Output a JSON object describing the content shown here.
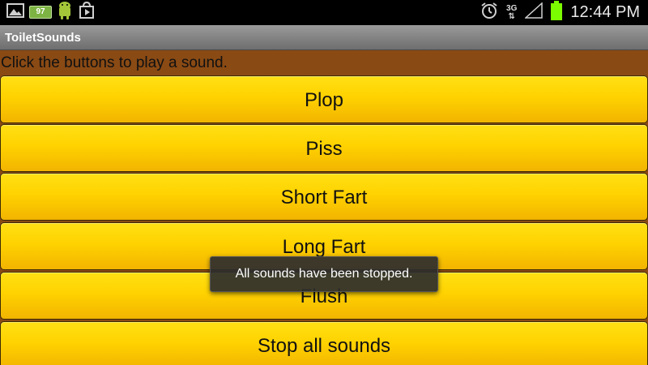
{
  "status_bar": {
    "notification_badge": "97",
    "network_type": "3G",
    "time": "12:44 PM",
    "icons": {
      "left": [
        "gallery-icon",
        "battery-badge-icon",
        "android-debug-icon",
        "play-store-icon"
      ],
      "right": [
        "alarm-icon",
        "network-arrows-icon",
        "signal-icon",
        "battery-icon"
      ]
    },
    "colors": {
      "background": "#000000",
      "battery": "#7cfc00"
    }
  },
  "app": {
    "title": "ToiletSounds",
    "instruction": "Click the buttons to play a sound."
  },
  "buttons": [
    {
      "label": "Plop"
    },
    {
      "label": "Piss"
    },
    {
      "label": "Short Fart"
    },
    {
      "label": "Long Fart"
    },
    {
      "label": "Flush"
    },
    {
      "label": "Stop all sounds"
    }
  ],
  "toast": {
    "message": "All sounds have been stopped."
  },
  "colors": {
    "background": "#8a4a14",
    "button": "#ffd200",
    "title_bar": "#808080"
  }
}
